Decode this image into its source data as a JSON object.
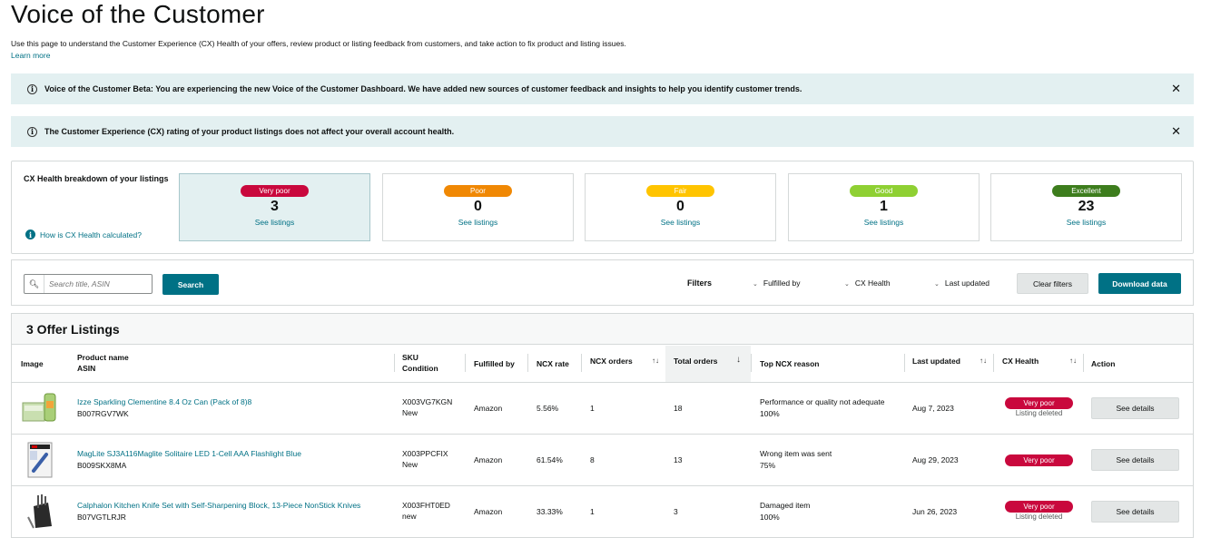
{
  "page": {
    "title": "Voice of the Customer",
    "intro": "Use this page to understand the Customer Experience (CX) Health of your offers, review product or listing feedback from customers, and take action to fix product and listing issues.",
    "learn_more": "Learn more"
  },
  "banners": [
    {
      "text": "Voice of the Customer Beta: You are experiencing the new Voice of the Customer Dashboard. We have added new sources of customer feedback and insights to help you identify customer trends."
    },
    {
      "text": "The Customer Experience (CX) rating of your product listings does not affect your overall account health."
    }
  ],
  "breakdown": {
    "title": "CX Health breakdown of your listings",
    "help_link": "How is CX Health calculated?",
    "cards": [
      {
        "label": "Very poor",
        "count": "3",
        "link": "See listings",
        "color": "#c9083d",
        "selected": true
      },
      {
        "label": "Poor",
        "count": "0",
        "link": "See listings",
        "color": "#f08804",
        "selected": false
      },
      {
        "label": "Fair",
        "count": "0",
        "link": "See listings",
        "color": "#ffc400",
        "selected": false
      },
      {
        "label": "Good",
        "count": "1",
        "link": "See listings",
        "color": "#8fd033",
        "selected": false
      },
      {
        "label": "Excellent",
        "count": "23",
        "link": "See listings",
        "color": "#3d7d1d",
        "selected": false
      }
    ]
  },
  "filterbar": {
    "search_placeholder": "Search title, ASIN",
    "search_button": "Search",
    "filters_label": "Filters",
    "dropdowns": [
      "Fulfilled by",
      "CX Health",
      "Last updated"
    ],
    "clear_button": "Clear filters",
    "download_button": "Download data"
  },
  "listings": {
    "title": "3 Offer Listings",
    "headers": {
      "image": "Image",
      "product_name": "Product name",
      "asin": "ASIN",
      "sku": "SKU",
      "condition": "Condition",
      "fulfilled_by": "Fulfilled by",
      "ncx_rate": "NCX rate",
      "ncx_orders": "NCX orders",
      "total_orders": "Total orders",
      "top_reason": "Top NCX reason",
      "last_updated": "Last updated",
      "cx_health": "CX Health",
      "action": "Action"
    },
    "rows": [
      {
        "name": "Izze Sparkling Clementine 8.4 Oz Can (Pack of 8)8",
        "asin": "B007RGV7WK",
        "sku": "X003VG7KGN",
        "condition": "New",
        "fulfilled_by": "Amazon",
        "ncx_rate": "5.56%",
        "ncx_orders": "1",
        "total_orders": "18",
        "reason": "Performance or quality not adequate",
        "reason_pct": "100%",
        "last_updated": "Aug 7, 2023",
        "health": "Very poor",
        "health_sub": "Listing deleted",
        "action": "See details",
        "thumb_icon": "soda-can-pack-thumbnail"
      },
      {
        "name": "MagLite SJ3A116Maglite Solitaire LED 1-Cell AAA Flashlight Blue",
        "asin": "B009SKX8MA",
        "sku": "X003PPCFIX",
        "condition": "New",
        "fulfilled_by": "Amazon",
        "ncx_rate": "61.54%",
        "ncx_orders": "8",
        "total_orders": "13",
        "reason": "Wrong item was sent",
        "reason_pct": "75%",
        "last_updated": "Aug 29, 2023",
        "health": "Very poor",
        "health_sub": "",
        "action": "See details",
        "thumb_icon": "flashlight-package-thumbnail"
      },
      {
        "name": "Calphalon Kitchen Knife Set with Self-Sharpening Block, 13-Piece NonStick Knives",
        "asin": "B07VGTLRJR",
        "sku": "X003FHT0ED",
        "condition": "new",
        "fulfilled_by": "Amazon",
        "ncx_rate": "33.33%",
        "ncx_orders": "1",
        "total_orders": "3",
        "reason": "Damaged item",
        "reason_pct": "100%",
        "last_updated": "Jun 26, 2023",
        "health": "Very poor",
        "health_sub": "Listing deleted",
        "action": "See details",
        "thumb_icon": "knife-block-thumbnail"
      }
    ]
  }
}
